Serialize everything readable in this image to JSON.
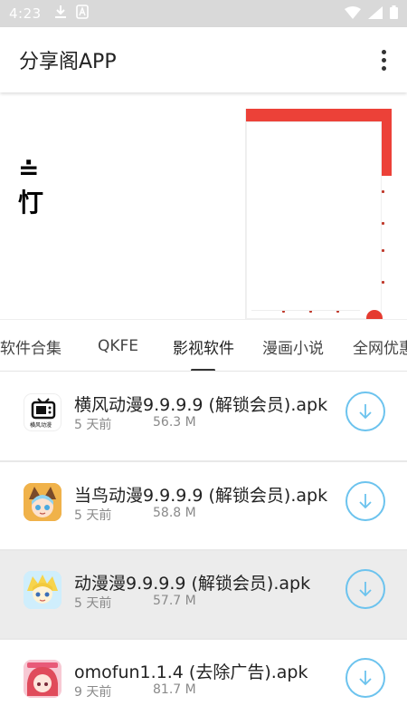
{
  "status_bar": {
    "time": "4:23",
    "left_icons": [
      "download-icon",
      "a-notification-icon"
    ],
    "right_icons": [
      "wifi-icon",
      "signal-icon",
      "battery-icon"
    ]
  },
  "app_bar": {
    "title": "分享阁APP",
    "menu_icon": "more-vert-icon"
  },
  "banner": {
    "glyph_line1": "≐",
    "glyph_line2": "忊"
  },
  "tabs": [
    {
      "label": "软件合集",
      "active": false
    },
    {
      "label": "QKFE",
      "active": false
    },
    {
      "label": "影视软件",
      "active": true
    },
    {
      "label": "漫画小说",
      "active": false
    },
    {
      "label": "全网优惠",
      "active": false
    }
  ],
  "list": [
    {
      "title": "横风动漫9.9.9.9 (解锁会员).apk",
      "time": "5 天前",
      "size": "56.3 M",
      "icon_text": "横风动漫",
      "highlighted": false
    },
    {
      "title": "当鸟动漫9.9.9.9 (解锁会员).apk",
      "time": "5 天前",
      "size": "58.8 M",
      "icon_text": "",
      "highlighted": false
    },
    {
      "title": "动漫漫9.9.9.9 (解锁会员).apk",
      "time": "5 天前",
      "size": "57.7 M",
      "icon_text": "",
      "highlighted": true
    },
    {
      "title": "omofun1.1.4 (去除广告).apk",
      "time": "9 天前",
      "size": "81.7 M",
      "icon_text": "",
      "highlighted": false
    }
  ],
  "colors": {
    "accent": "#6cc3ee",
    "status_bar": "#d9d9d9",
    "highlight_row": "#ececec",
    "banner_red": "#ec4138"
  }
}
